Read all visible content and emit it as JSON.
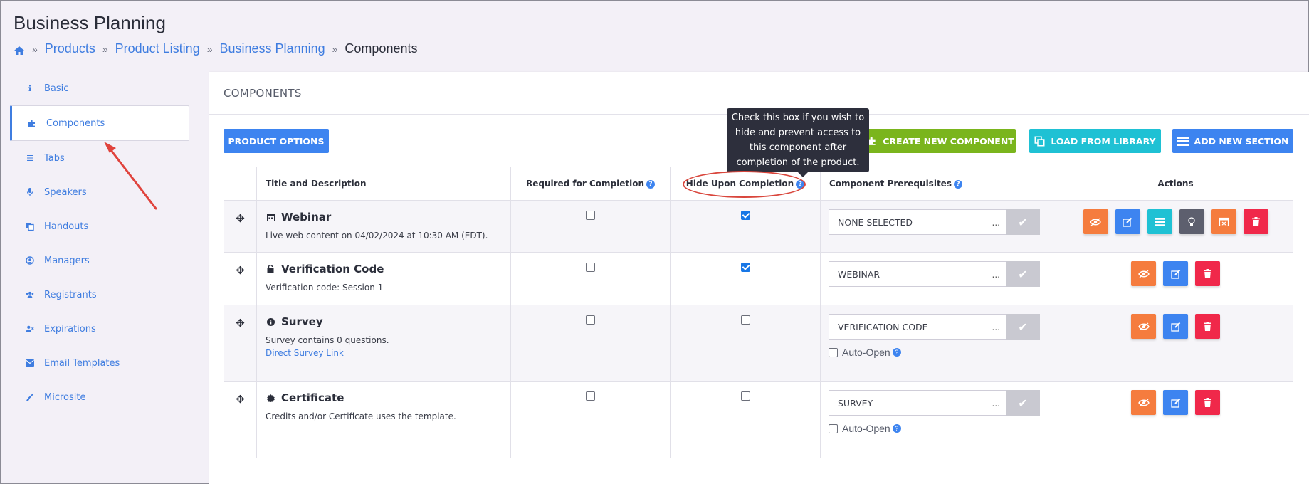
{
  "page": {
    "title": "Business Planning"
  },
  "breadcrumb": {
    "items": [
      "Products",
      "Product Listing",
      "Business Planning"
    ],
    "current": "Components",
    "separator": "»"
  },
  "sidebar": {
    "items": [
      {
        "label": "Basic",
        "icon": "info-icon"
      },
      {
        "label": "Components",
        "icon": "puzzle-icon",
        "active": true
      },
      {
        "label": "Tabs",
        "icon": "list-icon"
      },
      {
        "label": "Speakers",
        "icon": "microphone-icon"
      },
      {
        "label": "Handouts",
        "icon": "copy-icon"
      },
      {
        "label": "Managers",
        "icon": "user-circle-icon"
      },
      {
        "label": "Registrants",
        "icon": "users-icon"
      },
      {
        "label": "Expirations",
        "icon": "user-x-icon"
      },
      {
        "label": "Email Templates",
        "icon": "envelope-icon"
      },
      {
        "label": "Microsite",
        "icon": "brush-icon"
      }
    ]
  },
  "card": {
    "header": "COMPONENTS"
  },
  "toolbar": {
    "product_options": "PRODUCT OPTIONS",
    "create_new_component": "CREATE NEW COMPONENT",
    "load_from_library": "LOAD FROM LIBRARY",
    "add_new_section": "ADD NEW SECTION"
  },
  "tooltip": {
    "text": "Check this box if you wish to hide and prevent access to this component after completion of the product."
  },
  "table": {
    "columns": {
      "title": "Title and Description",
      "required": "Required for Completion",
      "hide": "Hide Upon Completion",
      "prereq": "Component Prerequisites",
      "actions": "Actions"
    },
    "auto_open_label": "Auto-Open",
    "rows": [
      {
        "title": "Webinar",
        "icon": "calendar-icon",
        "description": "Live web content on 04/02/2024 at 10:30 AM (EDT).",
        "link": "",
        "required": false,
        "hide": true,
        "prereq": "NONE SELECTED",
        "auto_open": false
      },
      {
        "title": "Verification Code",
        "icon": "unlock-icon",
        "description": "Verification code: Session 1",
        "link": "",
        "required": false,
        "hide": true,
        "prereq": "WEBINAR",
        "auto_open": false
      },
      {
        "title": "Survey",
        "icon": "info-icon",
        "description": "Survey contains 0 questions.",
        "link": "Direct Survey Link",
        "required": false,
        "hide": false,
        "prereq": "VERIFICATION CODE",
        "auto_open": false
      },
      {
        "title": "Certificate",
        "icon": "badge-icon",
        "description": "Credits and/or Certificate uses the template.",
        "link": "",
        "required": false,
        "hide": false,
        "prereq": "SURVEY",
        "auto_open": false
      }
    ]
  },
  "colors": {
    "accent": "#3d84f0",
    "green": "#7ab51d",
    "cyan": "#1fc1d4",
    "orange": "#f57c3e",
    "red": "#f0284a",
    "annotation": "#d9463c"
  }
}
